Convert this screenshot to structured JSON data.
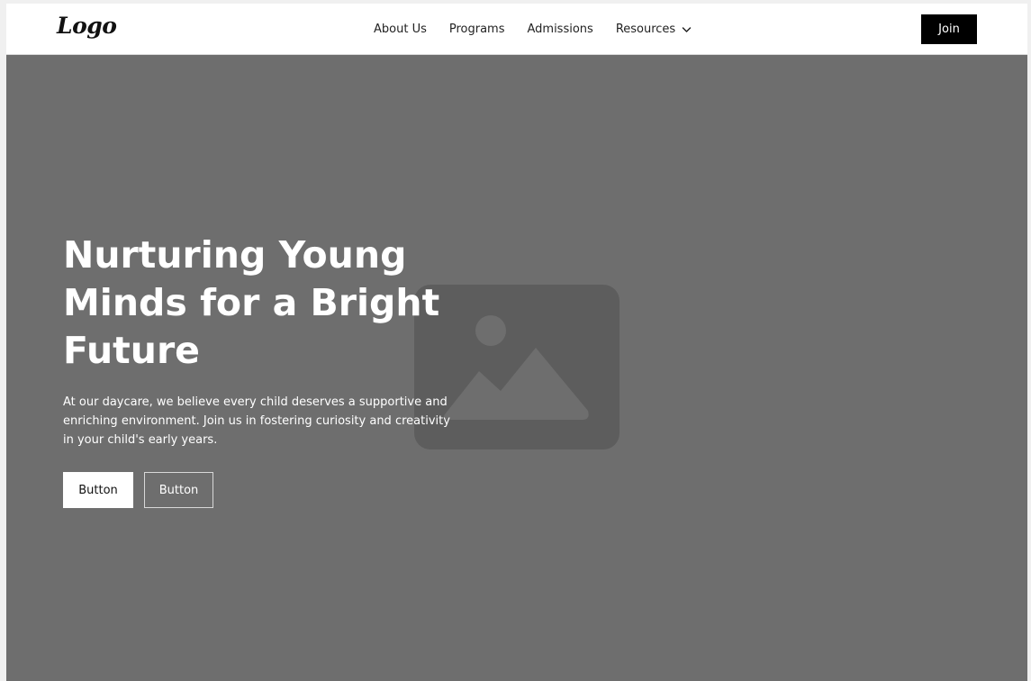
{
  "header": {
    "logo": "Logo",
    "nav": [
      {
        "label": "About Us"
      },
      {
        "label": "Programs"
      },
      {
        "label": "Admissions"
      },
      {
        "label": "Resources",
        "icon": "chevron-down-icon"
      }
    ],
    "cta_label": "Join"
  },
  "hero": {
    "title": "Nurturing Young Minds for a Bright Future",
    "description": "At our daycare, we believe every child deserves a supportive and enriching environment. Join us in fostering curiosity and creativity in your child's early years.",
    "primary_button": "Button",
    "secondary_button": "Button",
    "background_icon": "image-placeholder-icon"
  },
  "colors": {
    "hero_background": "#6e6e6e",
    "placeholder": "#5d5d5d",
    "nav_cta_background": "#000000",
    "text_light": "#ffffff"
  }
}
